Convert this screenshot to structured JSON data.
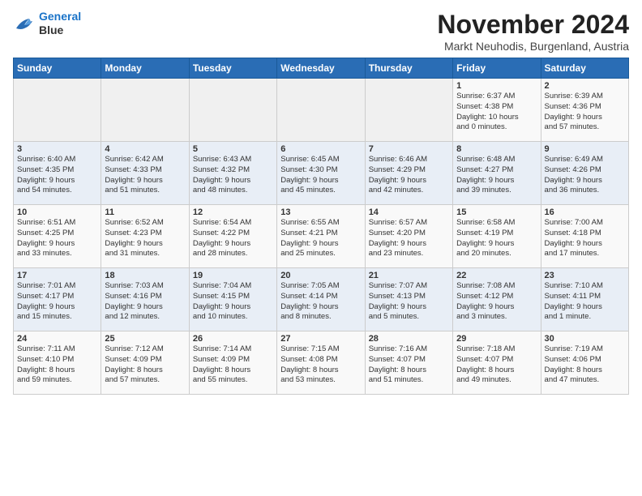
{
  "logo": {
    "line1": "General",
    "line2": "Blue"
  },
  "title": "November 2024",
  "subtitle": "Markt Neuhodis, Burgenland, Austria",
  "days_of_week": [
    "Sunday",
    "Monday",
    "Tuesday",
    "Wednesday",
    "Thursday",
    "Friday",
    "Saturday"
  ],
  "weeks": [
    [
      {
        "num": "",
        "info": ""
      },
      {
        "num": "",
        "info": ""
      },
      {
        "num": "",
        "info": ""
      },
      {
        "num": "",
        "info": ""
      },
      {
        "num": "",
        "info": ""
      },
      {
        "num": "1",
        "info": "Sunrise: 6:37 AM\nSunset: 4:38 PM\nDaylight: 10 hours\nand 0 minutes."
      },
      {
        "num": "2",
        "info": "Sunrise: 6:39 AM\nSunset: 4:36 PM\nDaylight: 9 hours\nand 57 minutes."
      }
    ],
    [
      {
        "num": "3",
        "info": "Sunrise: 6:40 AM\nSunset: 4:35 PM\nDaylight: 9 hours\nand 54 minutes."
      },
      {
        "num": "4",
        "info": "Sunrise: 6:42 AM\nSunset: 4:33 PM\nDaylight: 9 hours\nand 51 minutes."
      },
      {
        "num": "5",
        "info": "Sunrise: 6:43 AM\nSunset: 4:32 PM\nDaylight: 9 hours\nand 48 minutes."
      },
      {
        "num": "6",
        "info": "Sunrise: 6:45 AM\nSunset: 4:30 PM\nDaylight: 9 hours\nand 45 minutes."
      },
      {
        "num": "7",
        "info": "Sunrise: 6:46 AM\nSunset: 4:29 PM\nDaylight: 9 hours\nand 42 minutes."
      },
      {
        "num": "8",
        "info": "Sunrise: 6:48 AM\nSunset: 4:27 PM\nDaylight: 9 hours\nand 39 minutes."
      },
      {
        "num": "9",
        "info": "Sunrise: 6:49 AM\nSunset: 4:26 PM\nDaylight: 9 hours\nand 36 minutes."
      }
    ],
    [
      {
        "num": "10",
        "info": "Sunrise: 6:51 AM\nSunset: 4:25 PM\nDaylight: 9 hours\nand 33 minutes."
      },
      {
        "num": "11",
        "info": "Sunrise: 6:52 AM\nSunset: 4:23 PM\nDaylight: 9 hours\nand 31 minutes."
      },
      {
        "num": "12",
        "info": "Sunrise: 6:54 AM\nSunset: 4:22 PM\nDaylight: 9 hours\nand 28 minutes."
      },
      {
        "num": "13",
        "info": "Sunrise: 6:55 AM\nSunset: 4:21 PM\nDaylight: 9 hours\nand 25 minutes."
      },
      {
        "num": "14",
        "info": "Sunrise: 6:57 AM\nSunset: 4:20 PM\nDaylight: 9 hours\nand 23 minutes."
      },
      {
        "num": "15",
        "info": "Sunrise: 6:58 AM\nSunset: 4:19 PM\nDaylight: 9 hours\nand 20 minutes."
      },
      {
        "num": "16",
        "info": "Sunrise: 7:00 AM\nSunset: 4:18 PM\nDaylight: 9 hours\nand 17 minutes."
      }
    ],
    [
      {
        "num": "17",
        "info": "Sunrise: 7:01 AM\nSunset: 4:17 PM\nDaylight: 9 hours\nand 15 minutes."
      },
      {
        "num": "18",
        "info": "Sunrise: 7:03 AM\nSunset: 4:16 PM\nDaylight: 9 hours\nand 12 minutes."
      },
      {
        "num": "19",
        "info": "Sunrise: 7:04 AM\nSunset: 4:15 PM\nDaylight: 9 hours\nand 10 minutes."
      },
      {
        "num": "20",
        "info": "Sunrise: 7:05 AM\nSunset: 4:14 PM\nDaylight: 9 hours\nand 8 minutes."
      },
      {
        "num": "21",
        "info": "Sunrise: 7:07 AM\nSunset: 4:13 PM\nDaylight: 9 hours\nand 5 minutes."
      },
      {
        "num": "22",
        "info": "Sunrise: 7:08 AM\nSunset: 4:12 PM\nDaylight: 9 hours\nand 3 minutes."
      },
      {
        "num": "23",
        "info": "Sunrise: 7:10 AM\nSunset: 4:11 PM\nDaylight: 9 hours\nand 1 minute."
      }
    ],
    [
      {
        "num": "24",
        "info": "Sunrise: 7:11 AM\nSunset: 4:10 PM\nDaylight: 8 hours\nand 59 minutes."
      },
      {
        "num": "25",
        "info": "Sunrise: 7:12 AM\nSunset: 4:09 PM\nDaylight: 8 hours\nand 57 minutes."
      },
      {
        "num": "26",
        "info": "Sunrise: 7:14 AM\nSunset: 4:09 PM\nDaylight: 8 hours\nand 55 minutes."
      },
      {
        "num": "27",
        "info": "Sunrise: 7:15 AM\nSunset: 4:08 PM\nDaylight: 8 hours\nand 53 minutes."
      },
      {
        "num": "28",
        "info": "Sunrise: 7:16 AM\nSunset: 4:07 PM\nDaylight: 8 hours\nand 51 minutes."
      },
      {
        "num": "29",
        "info": "Sunrise: 7:18 AM\nSunset: 4:07 PM\nDaylight: 8 hours\nand 49 minutes."
      },
      {
        "num": "30",
        "info": "Sunrise: 7:19 AM\nSunset: 4:06 PM\nDaylight: 8 hours\nand 47 minutes."
      }
    ]
  ]
}
